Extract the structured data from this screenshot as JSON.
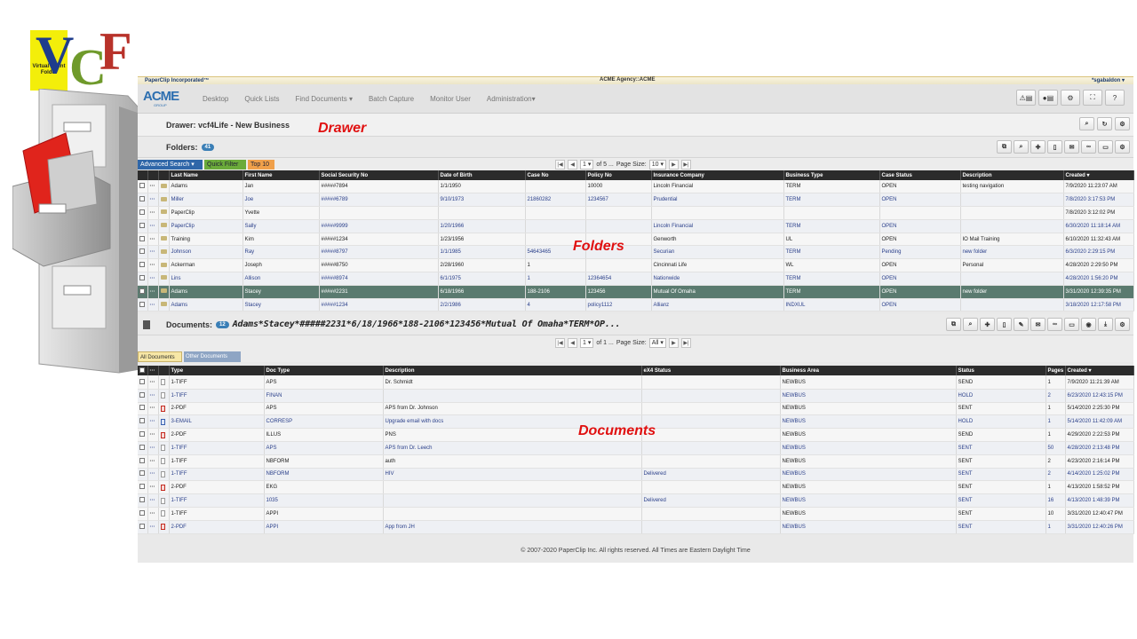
{
  "logo": {
    "letters": [
      "V",
      "C",
      "F"
    ],
    "badge_text": "Virtual Client Folder"
  },
  "app": {
    "brand": "PaperClip Incorporated™",
    "agency": "ACME Agency::ACME",
    "user": "*sgabaldon ▾",
    "nav_logo": "ACME",
    "nav_logo_sub": "GROUP",
    "nav": [
      "Desktop",
      "Quick Lists",
      "Find Documents ▾",
      "Batch Capture",
      "Monitor User",
      "Administration▾"
    ],
    "drawer_title": "Drawer: vcf4Life - New Business",
    "folders": {
      "label": "Folders:",
      "count": "41",
      "filters": {
        "advanced": "Advanced Search ▾",
        "quick": "Quick Filter",
        "top": "Top 10"
      },
      "pager": {
        "page": "1",
        "of": "of 5 ...",
        "page_size_label": "Page Size:",
        "page_size": "10"
      },
      "columns": [
        "Last Name",
        "First Name",
        "Social Security No",
        "Date of Birth",
        "Case No",
        "Policy No",
        "Insurance Company",
        "Business Type",
        "Case Status",
        "Description",
        "Created ▾"
      ],
      "rows": [
        [
          "Adams",
          "Jan",
          "#####7894",
          "1/1/1950",
          "",
          "10000",
          "Lincoln Financial",
          "TERM",
          "OPEN",
          "testing navigation",
          "7/9/2020 11:23:07 AM"
        ],
        [
          "Miller",
          "Joe",
          "#####6789",
          "9/10/1973",
          "21860282",
          "1234567",
          "Prudential",
          "TERM",
          "OPEN",
          "",
          "7/8/2020 3:17:53 PM"
        ],
        [
          "PaperClip",
          "Yvette",
          "",
          "",
          "",
          "",
          "",
          "",
          "",
          "",
          "7/8/2020 3:12:02 PM"
        ],
        [
          "PaperClip",
          "Sally",
          "#####9999",
          "1/20/1966",
          "",
          "",
          "Lincoln Financial",
          "TERM",
          "OPEN",
          "",
          "6/30/2020 11:18:14 AM"
        ],
        [
          "Training",
          "Kim",
          "#####1234",
          "1/23/1956",
          "",
          "",
          "Genworth",
          "UL",
          "OPEN",
          "IO Mail Training",
          "6/10/2020 11:32:43 AM"
        ],
        [
          "Johnson",
          "Ray",
          "#####8797",
          "1/1/1985",
          "54643465",
          "",
          "Securian",
          "TERM",
          "Pending",
          "new folder",
          "6/3/2020 2:29:15 PM"
        ],
        [
          "Ackerman",
          "Joseph",
          "#####8750",
          "2/28/1960",
          "1",
          "",
          "Cincinnati Life",
          "WL",
          "OPEN",
          "Personal",
          "4/28/2020 2:29:50 PM"
        ],
        [
          "Lins",
          "Allison",
          "#####8974",
          "6/1/1975",
          "1",
          "12364654",
          "Nationwide",
          "TERM",
          "OPEN",
          "",
          "4/28/2020 1:56:20 PM"
        ],
        [
          "Adams",
          "Stacey",
          "#####2231",
          "6/18/1966",
          "188-2106",
          "123456",
          "Mutual Of Omaha",
          "TERM",
          "OPEN",
          "new folder",
          "3/31/2020 12:39:35 PM"
        ],
        [
          "Adams",
          "Stacey",
          "#####1234",
          "2/2/1986",
          "4",
          "policy1112",
          "Allianz",
          "INDXUL",
          "OPEN",
          "",
          "3/18/2020 12:17:58 PM"
        ]
      ]
    },
    "documents": {
      "label": "Documents:",
      "count": "12",
      "crumb": "Adams*Stacey*#####2231*6/18/1966*188-2106*123456*Mutual Of Omaha*TERM*OP...",
      "pager": {
        "page": "1",
        "of": "of 1 ...",
        "page_size_label": "Page Size:",
        "page_size": "All"
      },
      "tabs": [
        "All Documents",
        "Other Documents"
      ],
      "columns": [
        "Type",
        "Doc Type",
        "Description",
        "eX4 Status",
        "Business Area",
        "Status",
        "Pages",
        "Created ▾"
      ],
      "rows": [
        [
          "tiff",
          "1-TIFF",
          "APS",
          "Dr. Schmidt",
          "",
          "NEWBUS",
          "SEND",
          "1",
          "7/9/2020 11:21:39 AM"
        ],
        [
          "tiff",
          "1-TIFF",
          "FINAN",
          "",
          "",
          "NEWBUS",
          "HOLD",
          "2",
          "6/23/2020 12:43:15 PM"
        ],
        [
          "pdf",
          "2-PDF",
          "APS",
          "APS from Dr. Johnson",
          "",
          "NEWBUS",
          "SENT",
          "1",
          "5/14/2020 2:25:30 PM"
        ],
        [
          "mail",
          "3-EMAIL",
          "CORRESP",
          "Upgrade email with docs",
          "",
          "NEWBUS",
          "HOLD",
          "1",
          "5/14/2020 11:42:09 AM"
        ],
        [
          "pdf",
          "2-PDF",
          "ILLUS",
          "PNS",
          "",
          "NEWBUS",
          "SEND",
          "1",
          "4/29/2020 2:22:53 PM"
        ],
        [
          "tiff",
          "1-TIFF",
          "APS",
          "APS from Dr. Leech",
          "",
          "NEWBUS",
          "SENT",
          "50",
          "4/28/2020 2:13:48 PM"
        ],
        [
          "tiff",
          "1-TIFF",
          "NBFORM",
          "auth",
          "",
          "NEWBUS",
          "SENT",
          "2",
          "4/23/2020 2:16:14 PM"
        ],
        [
          "tiff",
          "1-TIFF",
          "NBFORM",
          "HIV",
          "Delivered",
          "NEWBUS",
          "SENT",
          "2",
          "4/14/2020 1:25:02 PM"
        ],
        [
          "pdf",
          "2-PDF",
          "EKG",
          "",
          "",
          "NEWBUS",
          "SENT",
          "1",
          "4/13/2020 1:58:52 PM"
        ],
        [
          "tiff",
          "1-TIFF",
          "1035",
          "",
          "Delivered",
          "NEWBUS",
          "SENT",
          "16",
          "4/13/2020 1:48:39 PM"
        ],
        [
          "tiff",
          "1-TIFF",
          "APPI",
          "",
          "",
          "NEWBUS",
          "SENT",
          "10",
          "3/31/2020 12:40:47 PM"
        ],
        [
          "pdf",
          "2-PDF",
          "APPI",
          "App from JH",
          "",
          "NEWBUS",
          "SENT",
          "1",
          "3/31/2020 12:40:26 PM"
        ]
      ]
    },
    "footer": "© 2007-2020 PaperClip Inc. All rights reserved. All Times are Eastern Daylight Time"
  },
  "callouts": {
    "drawer": "Drawer",
    "folders": "Folders",
    "documents": "Documents"
  },
  "colors": {
    "accent": "#2b2b2b",
    "selected_row": "#5a7a6f",
    "callout": "#e01010"
  }
}
